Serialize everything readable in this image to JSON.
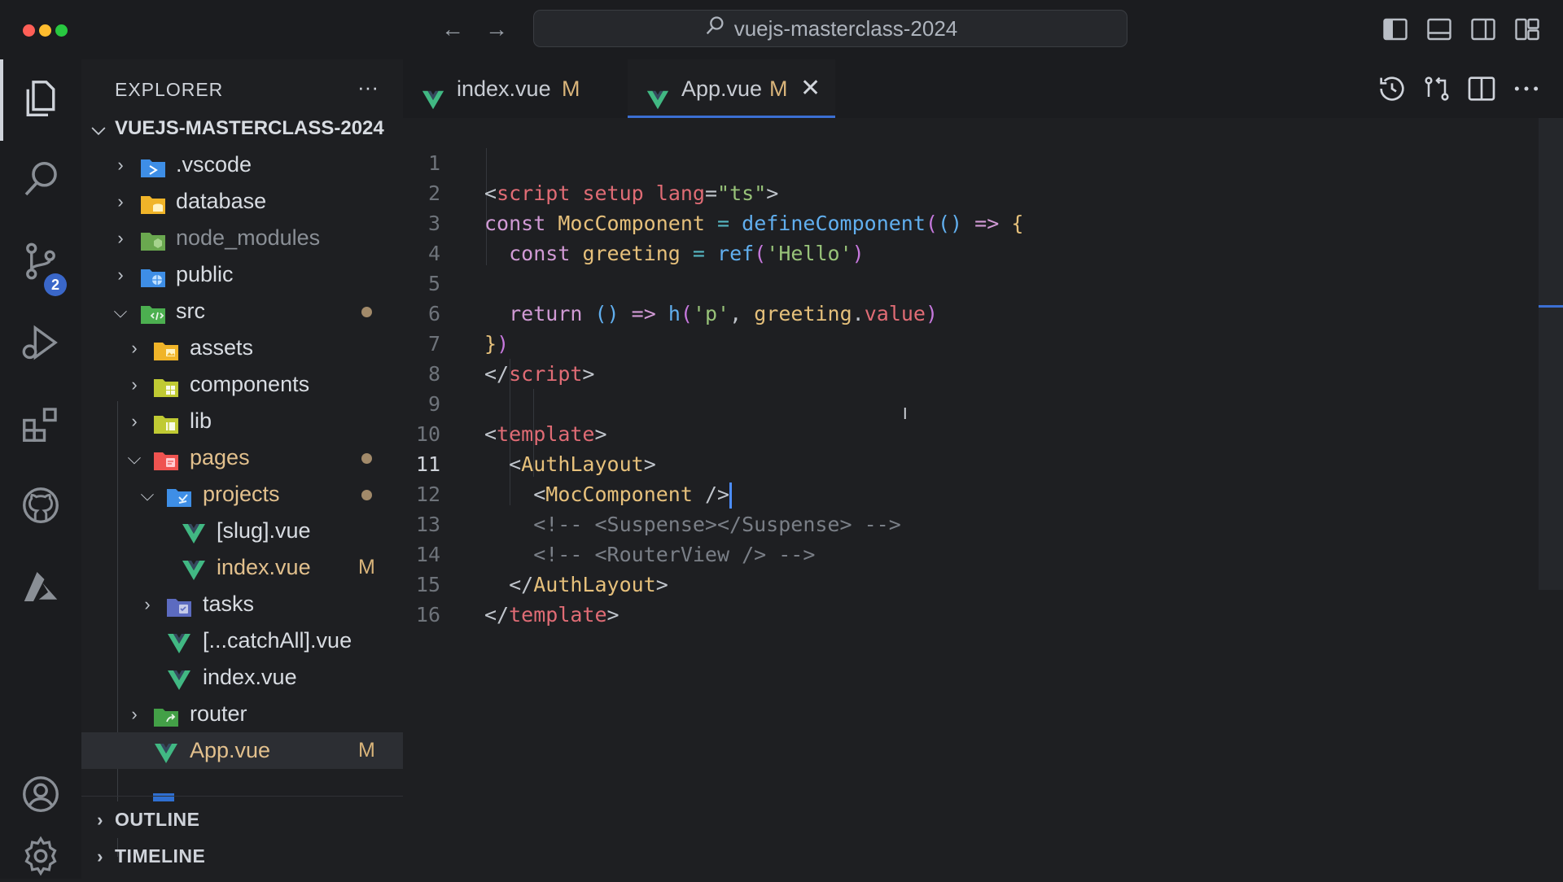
{
  "titlebar": {
    "search_text": "vuejs-masterclass-2024",
    "back_glyph": "←",
    "forward_glyph": "→"
  },
  "activity_bar": {
    "items": [
      "explorer-icon",
      "search-icon",
      "source-control-icon",
      "run-debug-icon",
      "extensions-icon",
      "github-icon",
      "azure-icon"
    ],
    "source_control_badge": "2",
    "bottom": [
      "account-icon",
      "gear-icon"
    ]
  },
  "explorer": {
    "header": "EXPLORER",
    "more": "···",
    "root": "VUEJS-MASTERCLASS-2024",
    "tree": [
      {
        "label": ".vscode",
        "depth": 1,
        "type": "folder-vscode",
        "expanded": false
      },
      {
        "label": "database",
        "depth": 1,
        "type": "folder-db",
        "expanded": false
      },
      {
        "label": "node_modules",
        "depth": 1,
        "type": "folder-node",
        "expanded": false,
        "dim": true
      },
      {
        "label": "public",
        "depth": 1,
        "type": "folder-public",
        "expanded": false
      },
      {
        "label": "src",
        "depth": 1,
        "type": "folder-src",
        "expanded": true,
        "dot": true
      },
      {
        "label": "assets",
        "depth": 2,
        "type": "folder-assets",
        "expanded": false
      },
      {
        "label": "components",
        "depth": 2,
        "type": "folder-components",
        "expanded": false
      },
      {
        "label": "lib",
        "depth": 2,
        "type": "folder-lib",
        "expanded": false
      },
      {
        "label": "pages",
        "depth": 2,
        "type": "folder-pages",
        "expanded": true,
        "dot": true
      },
      {
        "label": "projects",
        "depth": 3,
        "type": "folder-projects",
        "expanded": true,
        "dot": true
      },
      {
        "label": "[slug].vue",
        "depth": 4,
        "type": "vue"
      },
      {
        "label": "index.vue",
        "depth": 4,
        "type": "vue",
        "modified": "M"
      },
      {
        "label": "tasks",
        "depth": 3,
        "type": "folder-tasks",
        "expanded": false
      },
      {
        "label": "[...catchAll].vue",
        "depth": 3,
        "type": "vue"
      },
      {
        "label": "index.vue",
        "depth": 3,
        "type": "vue"
      },
      {
        "label": "router",
        "depth": 2,
        "type": "folder-router",
        "expanded": false
      },
      {
        "label": "App.vue",
        "depth": 2,
        "type": "vue",
        "modified": "M",
        "selected": true
      }
    ],
    "sections": [
      "OUTLINE",
      "TIMELINE"
    ]
  },
  "tabs": [
    {
      "label": "index.vue",
      "modified": "M",
      "active": false
    },
    {
      "label": "App.vue",
      "modified": "M",
      "active": true,
      "close": "✕"
    }
  ],
  "editor": {
    "line_numbers": [
      "1",
      "2",
      "3",
      "4",
      "5",
      "6",
      "7",
      "8",
      "9",
      "10",
      "11",
      "12",
      "13",
      "14",
      "15",
      "16"
    ],
    "current_line": 11
  },
  "colors": {
    "accent": "#3b6fd3",
    "modified": "#e2c08d",
    "vue_green": "#41b883"
  }
}
